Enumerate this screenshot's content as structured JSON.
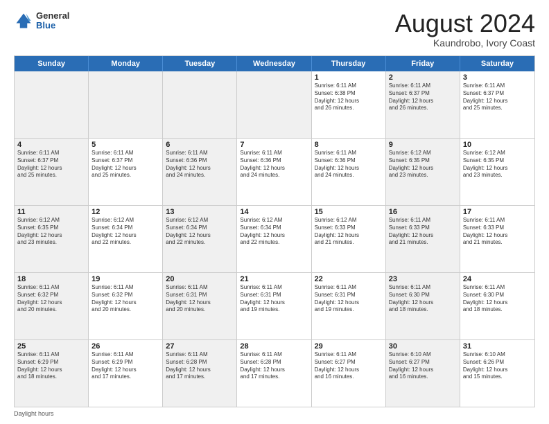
{
  "header": {
    "logo_general": "General",
    "logo_blue": "Blue",
    "month_title": "August 2024",
    "subtitle": "Kaundrobo, Ivory Coast"
  },
  "days": [
    "Sunday",
    "Monday",
    "Tuesday",
    "Wednesday",
    "Thursday",
    "Friday",
    "Saturday"
  ],
  "weeks": [
    [
      {
        "num": "",
        "text": "",
        "shaded": true
      },
      {
        "num": "",
        "text": "",
        "shaded": true
      },
      {
        "num": "",
        "text": "",
        "shaded": true
      },
      {
        "num": "",
        "text": "",
        "shaded": true
      },
      {
        "num": "1",
        "text": "Sunrise: 6:11 AM\nSunset: 6:38 PM\nDaylight: 12 hours\nand 26 minutes.",
        "shaded": false
      },
      {
        "num": "2",
        "text": "Sunrise: 6:11 AM\nSunset: 6:37 PM\nDaylight: 12 hours\nand 26 minutes.",
        "shaded": true
      },
      {
        "num": "3",
        "text": "Sunrise: 6:11 AM\nSunset: 6:37 PM\nDaylight: 12 hours\nand 25 minutes.",
        "shaded": false
      }
    ],
    [
      {
        "num": "4",
        "text": "Sunrise: 6:11 AM\nSunset: 6:37 PM\nDaylight: 12 hours\nand 25 minutes.",
        "shaded": true
      },
      {
        "num": "5",
        "text": "Sunrise: 6:11 AM\nSunset: 6:37 PM\nDaylight: 12 hours\nand 25 minutes.",
        "shaded": false
      },
      {
        "num": "6",
        "text": "Sunrise: 6:11 AM\nSunset: 6:36 PM\nDaylight: 12 hours\nand 24 minutes.",
        "shaded": true
      },
      {
        "num": "7",
        "text": "Sunrise: 6:11 AM\nSunset: 6:36 PM\nDaylight: 12 hours\nand 24 minutes.",
        "shaded": false
      },
      {
        "num": "8",
        "text": "Sunrise: 6:11 AM\nSunset: 6:36 PM\nDaylight: 12 hours\nand 24 minutes.",
        "shaded": false
      },
      {
        "num": "9",
        "text": "Sunrise: 6:12 AM\nSunset: 6:35 PM\nDaylight: 12 hours\nand 23 minutes.",
        "shaded": true
      },
      {
        "num": "10",
        "text": "Sunrise: 6:12 AM\nSunset: 6:35 PM\nDaylight: 12 hours\nand 23 minutes.",
        "shaded": false
      }
    ],
    [
      {
        "num": "11",
        "text": "Sunrise: 6:12 AM\nSunset: 6:35 PM\nDaylight: 12 hours\nand 23 minutes.",
        "shaded": true
      },
      {
        "num": "12",
        "text": "Sunrise: 6:12 AM\nSunset: 6:34 PM\nDaylight: 12 hours\nand 22 minutes.",
        "shaded": false
      },
      {
        "num": "13",
        "text": "Sunrise: 6:12 AM\nSunset: 6:34 PM\nDaylight: 12 hours\nand 22 minutes.",
        "shaded": true
      },
      {
        "num": "14",
        "text": "Sunrise: 6:12 AM\nSunset: 6:34 PM\nDaylight: 12 hours\nand 22 minutes.",
        "shaded": false
      },
      {
        "num": "15",
        "text": "Sunrise: 6:12 AM\nSunset: 6:33 PM\nDaylight: 12 hours\nand 21 minutes.",
        "shaded": false
      },
      {
        "num": "16",
        "text": "Sunrise: 6:11 AM\nSunset: 6:33 PM\nDaylight: 12 hours\nand 21 minutes.",
        "shaded": true
      },
      {
        "num": "17",
        "text": "Sunrise: 6:11 AM\nSunset: 6:33 PM\nDaylight: 12 hours\nand 21 minutes.",
        "shaded": false
      }
    ],
    [
      {
        "num": "18",
        "text": "Sunrise: 6:11 AM\nSunset: 6:32 PM\nDaylight: 12 hours\nand 20 minutes.",
        "shaded": true
      },
      {
        "num": "19",
        "text": "Sunrise: 6:11 AM\nSunset: 6:32 PM\nDaylight: 12 hours\nand 20 minutes.",
        "shaded": false
      },
      {
        "num": "20",
        "text": "Sunrise: 6:11 AM\nSunset: 6:31 PM\nDaylight: 12 hours\nand 20 minutes.",
        "shaded": true
      },
      {
        "num": "21",
        "text": "Sunrise: 6:11 AM\nSunset: 6:31 PM\nDaylight: 12 hours\nand 19 minutes.",
        "shaded": false
      },
      {
        "num": "22",
        "text": "Sunrise: 6:11 AM\nSunset: 6:31 PM\nDaylight: 12 hours\nand 19 minutes.",
        "shaded": false
      },
      {
        "num": "23",
        "text": "Sunrise: 6:11 AM\nSunset: 6:30 PM\nDaylight: 12 hours\nand 18 minutes.",
        "shaded": true
      },
      {
        "num": "24",
        "text": "Sunrise: 6:11 AM\nSunset: 6:30 PM\nDaylight: 12 hours\nand 18 minutes.",
        "shaded": false
      }
    ],
    [
      {
        "num": "25",
        "text": "Sunrise: 6:11 AM\nSunset: 6:29 PM\nDaylight: 12 hours\nand 18 minutes.",
        "shaded": true
      },
      {
        "num": "26",
        "text": "Sunrise: 6:11 AM\nSunset: 6:29 PM\nDaylight: 12 hours\nand 17 minutes.",
        "shaded": false
      },
      {
        "num": "27",
        "text": "Sunrise: 6:11 AM\nSunset: 6:28 PM\nDaylight: 12 hours\nand 17 minutes.",
        "shaded": true
      },
      {
        "num": "28",
        "text": "Sunrise: 6:11 AM\nSunset: 6:28 PM\nDaylight: 12 hours\nand 17 minutes.",
        "shaded": false
      },
      {
        "num": "29",
        "text": "Sunrise: 6:11 AM\nSunset: 6:27 PM\nDaylight: 12 hours\nand 16 minutes.",
        "shaded": false
      },
      {
        "num": "30",
        "text": "Sunrise: 6:10 AM\nSunset: 6:27 PM\nDaylight: 12 hours\nand 16 minutes.",
        "shaded": true
      },
      {
        "num": "31",
        "text": "Sunrise: 6:10 AM\nSunset: 6:26 PM\nDaylight: 12 hours\nand 15 minutes.",
        "shaded": false
      }
    ]
  ],
  "footer": "Daylight hours"
}
